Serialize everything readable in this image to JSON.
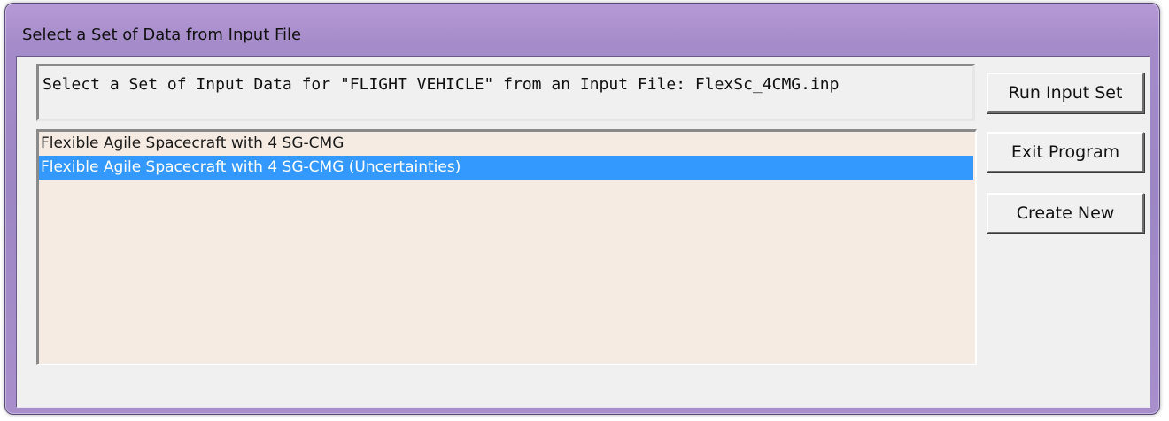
{
  "window": {
    "title": "Select a Set of Data from Input File"
  },
  "header": {
    "text": "Select a Set of Input Data for \"FLIGHT VEHICLE\" from an Input File: FlexSc_4CMG.inp"
  },
  "list": {
    "items": [
      {
        "label": "Flexible Agile Spacecraft with 4 SG-CMG",
        "selected": false
      },
      {
        "label": "Flexible Agile Spacecraft with 4 SG-CMG (Uncertainties)",
        "selected": true
      }
    ]
  },
  "buttons": {
    "run_label": "Run Input Set",
    "exit_label": "Exit Program",
    "create_label": "Create New"
  },
  "colors": {
    "title_bar": "#a58bc9",
    "selection": "#3399ff",
    "list_background": "#f5ebe2"
  }
}
